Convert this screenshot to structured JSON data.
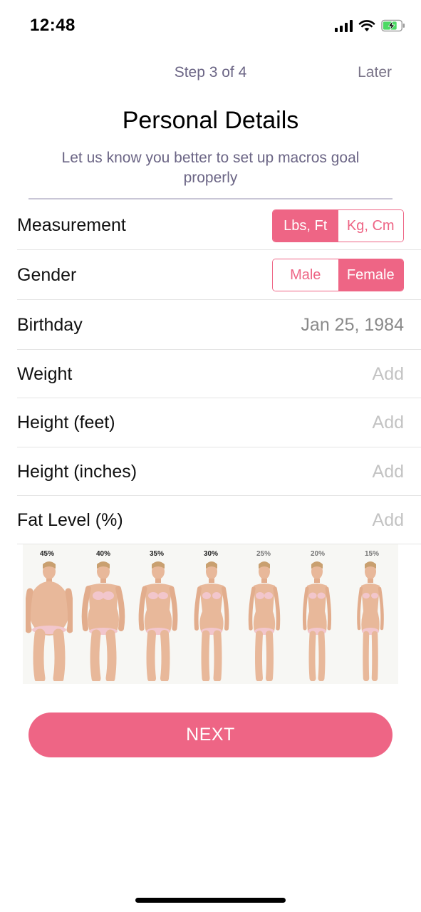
{
  "status_bar": {
    "time": "12:48"
  },
  "header": {
    "step": "Step 3 of 4",
    "later": "Later",
    "title": "Personal Details",
    "subtitle": "Let us know you better to set up macros goal properly"
  },
  "form": {
    "measurement": {
      "label": "Measurement",
      "options": [
        "Lbs, Ft",
        "Kg, Cm"
      ],
      "selected": "Lbs, Ft"
    },
    "gender": {
      "label": "Gender",
      "options": [
        "Male",
        "Female"
      ],
      "selected": "Female"
    },
    "birthday": {
      "label": "Birthday",
      "value": "Jan 25, 1984"
    },
    "weight": {
      "label": "Weight",
      "placeholder": "Add"
    },
    "height_feet": {
      "label": "Height (feet)",
      "placeholder": "Add"
    },
    "height_inches": {
      "label": "Height (inches)",
      "placeholder": "Add"
    },
    "fat_level": {
      "label": "Fat Level (%)",
      "placeholder": "Add"
    }
  },
  "fat_chart": {
    "levels": [
      "45%",
      "40%",
      "35%",
      "30%",
      "25%",
      "20%",
      "15%"
    ]
  },
  "next_button": "NEXT",
  "colors": {
    "accent": "#ee6585",
    "muted_text": "#6b6585",
    "placeholder": "#c3c3c3"
  }
}
